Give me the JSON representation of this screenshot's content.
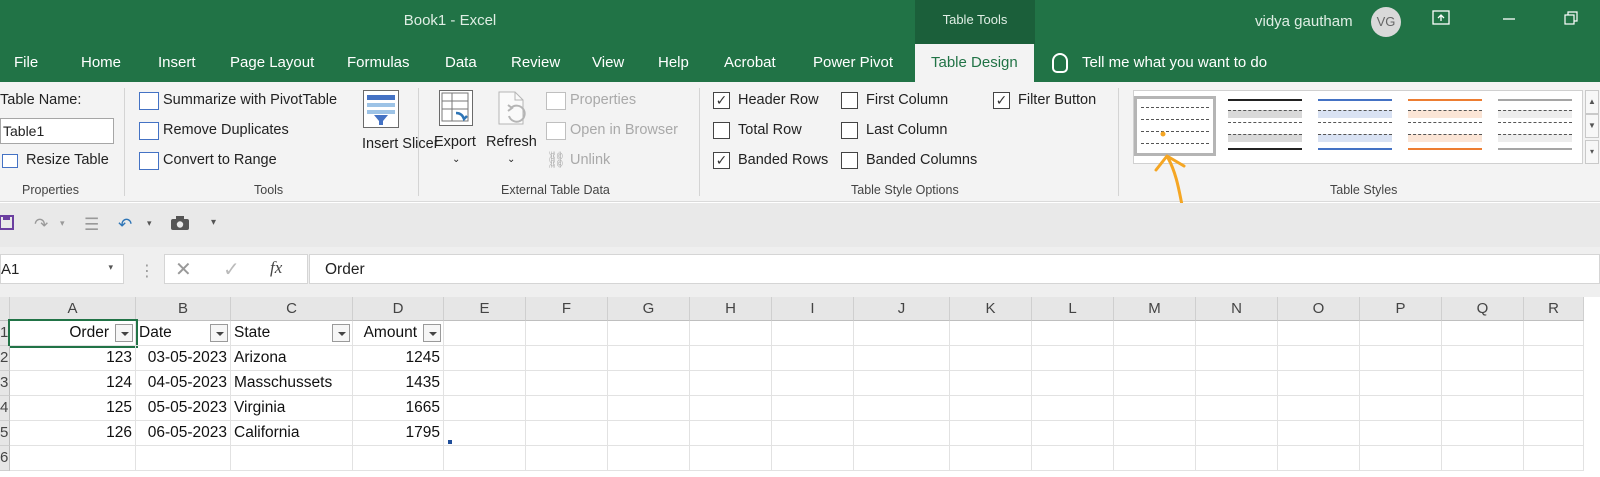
{
  "window": {
    "title": "Book1  -  Excel",
    "context_tab_group": "Table Tools",
    "user_name": "vidya gautham",
    "user_initials": "VG"
  },
  "tabs": [
    {
      "label": "File"
    },
    {
      "label": "Home"
    },
    {
      "label": "Insert"
    },
    {
      "label": "Page Layout"
    },
    {
      "label": "Formulas"
    },
    {
      "label": "Data"
    },
    {
      "label": "Review"
    },
    {
      "label": "View"
    },
    {
      "label": "Help"
    },
    {
      "label": "Acrobat"
    },
    {
      "label": "Power Pivot"
    },
    {
      "label": "Table Design"
    }
  ],
  "active_tab": "Table Design",
  "tell_me": "Tell me what you want to do",
  "ribbon": {
    "properties": {
      "table_name_label": "Table Name:",
      "table_name_value": "Table1",
      "resize_table": "Resize Table",
      "group_label": "Properties"
    },
    "tools": {
      "summarize_pivot": "Summarize with PivotTable",
      "remove_duplicates": "Remove Duplicates",
      "convert_to_range": "Convert to Range",
      "insert_slicer": "Insert Slicer",
      "group_label": "Tools"
    },
    "external": {
      "export": "Export",
      "refresh": "Refresh",
      "properties": "Properties",
      "open_in_browser": "Open in Browser",
      "unlink": "Unlink",
      "group_label": "External Table Data"
    },
    "style_options": {
      "header_row": {
        "label": "Header Row",
        "checked": true
      },
      "total_row": {
        "label": "Total Row",
        "checked": false
      },
      "banded_rows": {
        "label": "Banded Rows",
        "checked": true
      },
      "first_column": {
        "label": "First Column",
        "checked": false
      },
      "last_column": {
        "label": "Last Column",
        "checked": false
      },
      "banded_columns": {
        "label": "Banded Columns",
        "checked": false
      },
      "filter_button": {
        "label": "Filter Button",
        "checked": true
      },
      "group_label": "Table Style Options"
    },
    "table_styles": {
      "group_label": "Table Styles",
      "swatch_colors": [
        "#555555",
        "#7f7f7f",
        "#4472c4",
        "#ed7d31",
        "#a5a5a5"
      ],
      "annotation_color": "#f5a623"
    }
  },
  "formula_bar": {
    "name_box": "A1",
    "fx_label": "fx",
    "formula": "Order"
  },
  "sheet": {
    "column_headers": [
      "A",
      "B",
      "C",
      "D",
      "E",
      "F",
      "G",
      "H",
      "I",
      "J",
      "K",
      "L",
      "M",
      "N",
      "O",
      "P",
      "Q",
      "R"
    ],
    "row_headers": [
      "1",
      "2",
      "3",
      "4",
      "5",
      "6"
    ],
    "table_headers": [
      "Order",
      "Date",
      "State",
      "Amount"
    ],
    "rows": [
      [
        "123",
        "03-05-2023",
        "Arizona",
        "1245"
      ],
      [
        "124",
        "04-05-2023",
        "Masschussets",
        "1435"
      ],
      [
        "125",
        "05-05-2023",
        "Virginia",
        "1665"
      ],
      [
        "126",
        "06-05-2023",
        "California",
        "1795"
      ]
    ]
  }
}
